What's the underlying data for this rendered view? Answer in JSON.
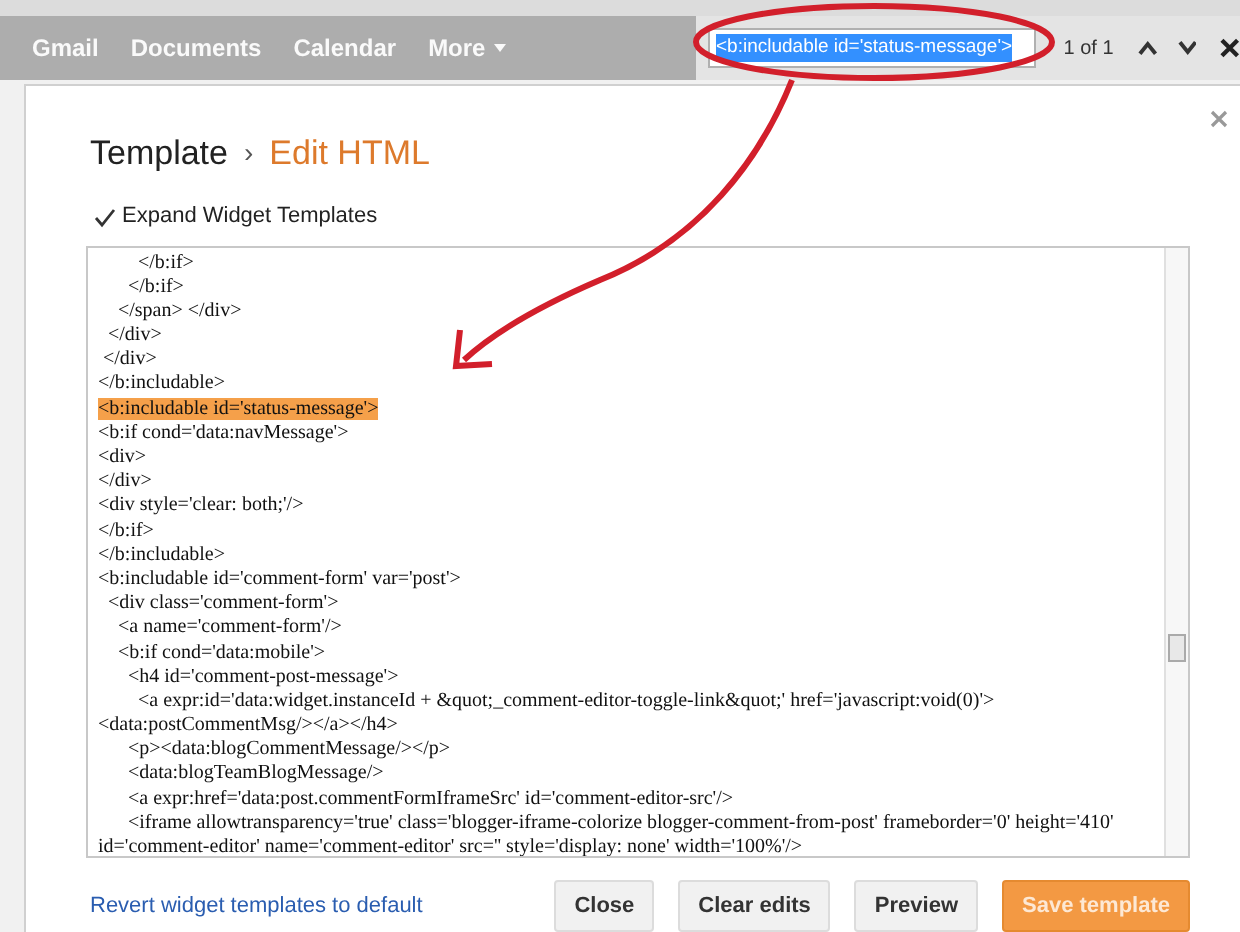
{
  "top_nav": {
    "links": [
      {
        "label": "Gmail"
      },
      {
        "label": "Documents"
      },
      {
        "label": "Calendar"
      },
      {
        "label": "More",
        "dropdown": true
      }
    ]
  },
  "find_bar": {
    "query": "<b:includable id='status-message'>",
    "count": "1 of 1"
  },
  "dialog": {
    "breadcrumb": {
      "parent": "Template",
      "separator": "›",
      "current": "Edit HTML"
    },
    "expand_widget_templates": {
      "label": "Expand Widget Templates",
      "checked": true
    },
    "code_lines": [
      {
        "text": "        </b:if>",
        "highlighted": false
      },
      {
        "text": "      </b:if>",
        "highlighted": false
      },
      {
        "text": "    </span> </div>",
        "highlighted": false
      },
      {
        "text": "  </div>",
        "highlighted": false
      },
      {
        "text": " </div>",
        "highlighted": false
      },
      {
        "text": "</b:includable>",
        "highlighted": false
      },
      {
        "text": "<b:includable id='status-message'>",
        "highlighted": true
      },
      {
        "text": "<b:if cond='data:navMessage'>",
        "highlighted": false
      },
      {
        "text": "<div>",
        "highlighted": false
      },
      {
        "text": "</div>",
        "highlighted": false
      },
      {
        "text": "<div style='clear: both;'/>",
        "highlighted": false
      },
      {
        "text": "</b:if>",
        "highlighted": false
      },
      {
        "text": "</b:includable>",
        "highlighted": false
      },
      {
        "text": "<b:includable id='comment-form' var='post'>",
        "highlighted": false
      },
      {
        "text": "  <div class='comment-form'>",
        "highlighted": false
      },
      {
        "text": "    <a name='comment-form'/>",
        "highlighted": false
      },
      {
        "text": "    <b:if cond='data:mobile'>",
        "highlighted": false
      },
      {
        "text": "      <h4 id='comment-post-message'>",
        "highlighted": false
      },
      {
        "text": "        <a expr:id='data:widget.instanceId + &quot;_comment-editor-toggle-link&quot;' href='javascript:void(0)'>",
        "highlighted": false
      },
      {
        "text": "<data:postCommentMsg/></a></h4>",
        "highlighted": false
      },
      {
        "text": "      <p><data:blogCommentMessage/></p>",
        "highlighted": false
      },
      {
        "text": "      <data:blogTeamBlogMessage/>",
        "highlighted": false
      },
      {
        "text": "      <a expr:href='data:post.commentFormIframeSrc' id='comment-editor-src'/>",
        "highlighted": false
      },
      {
        "text": "      <iframe allowtransparency='true' class='blogger-iframe-colorize blogger-comment-from-post' frameborder='0' height='410'",
        "highlighted": false
      },
      {
        "text": "id='comment-editor' name='comment-editor' src='' style='display: none' width='100%'/>",
        "highlighted": false
      }
    ],
    "revert_link": "Revert widget templates to default",
    "buttons": [
      {
        "label": "Close",
        "kind": "default"
      },
      {
        "label": "Clear edits",
        "kind": "default"
      },
      {
        "label": "Preview",
        "kind": "default"
      },
      {
        "label": "Save template",
        "kind": "primary"
      }
    ]
  }
}
